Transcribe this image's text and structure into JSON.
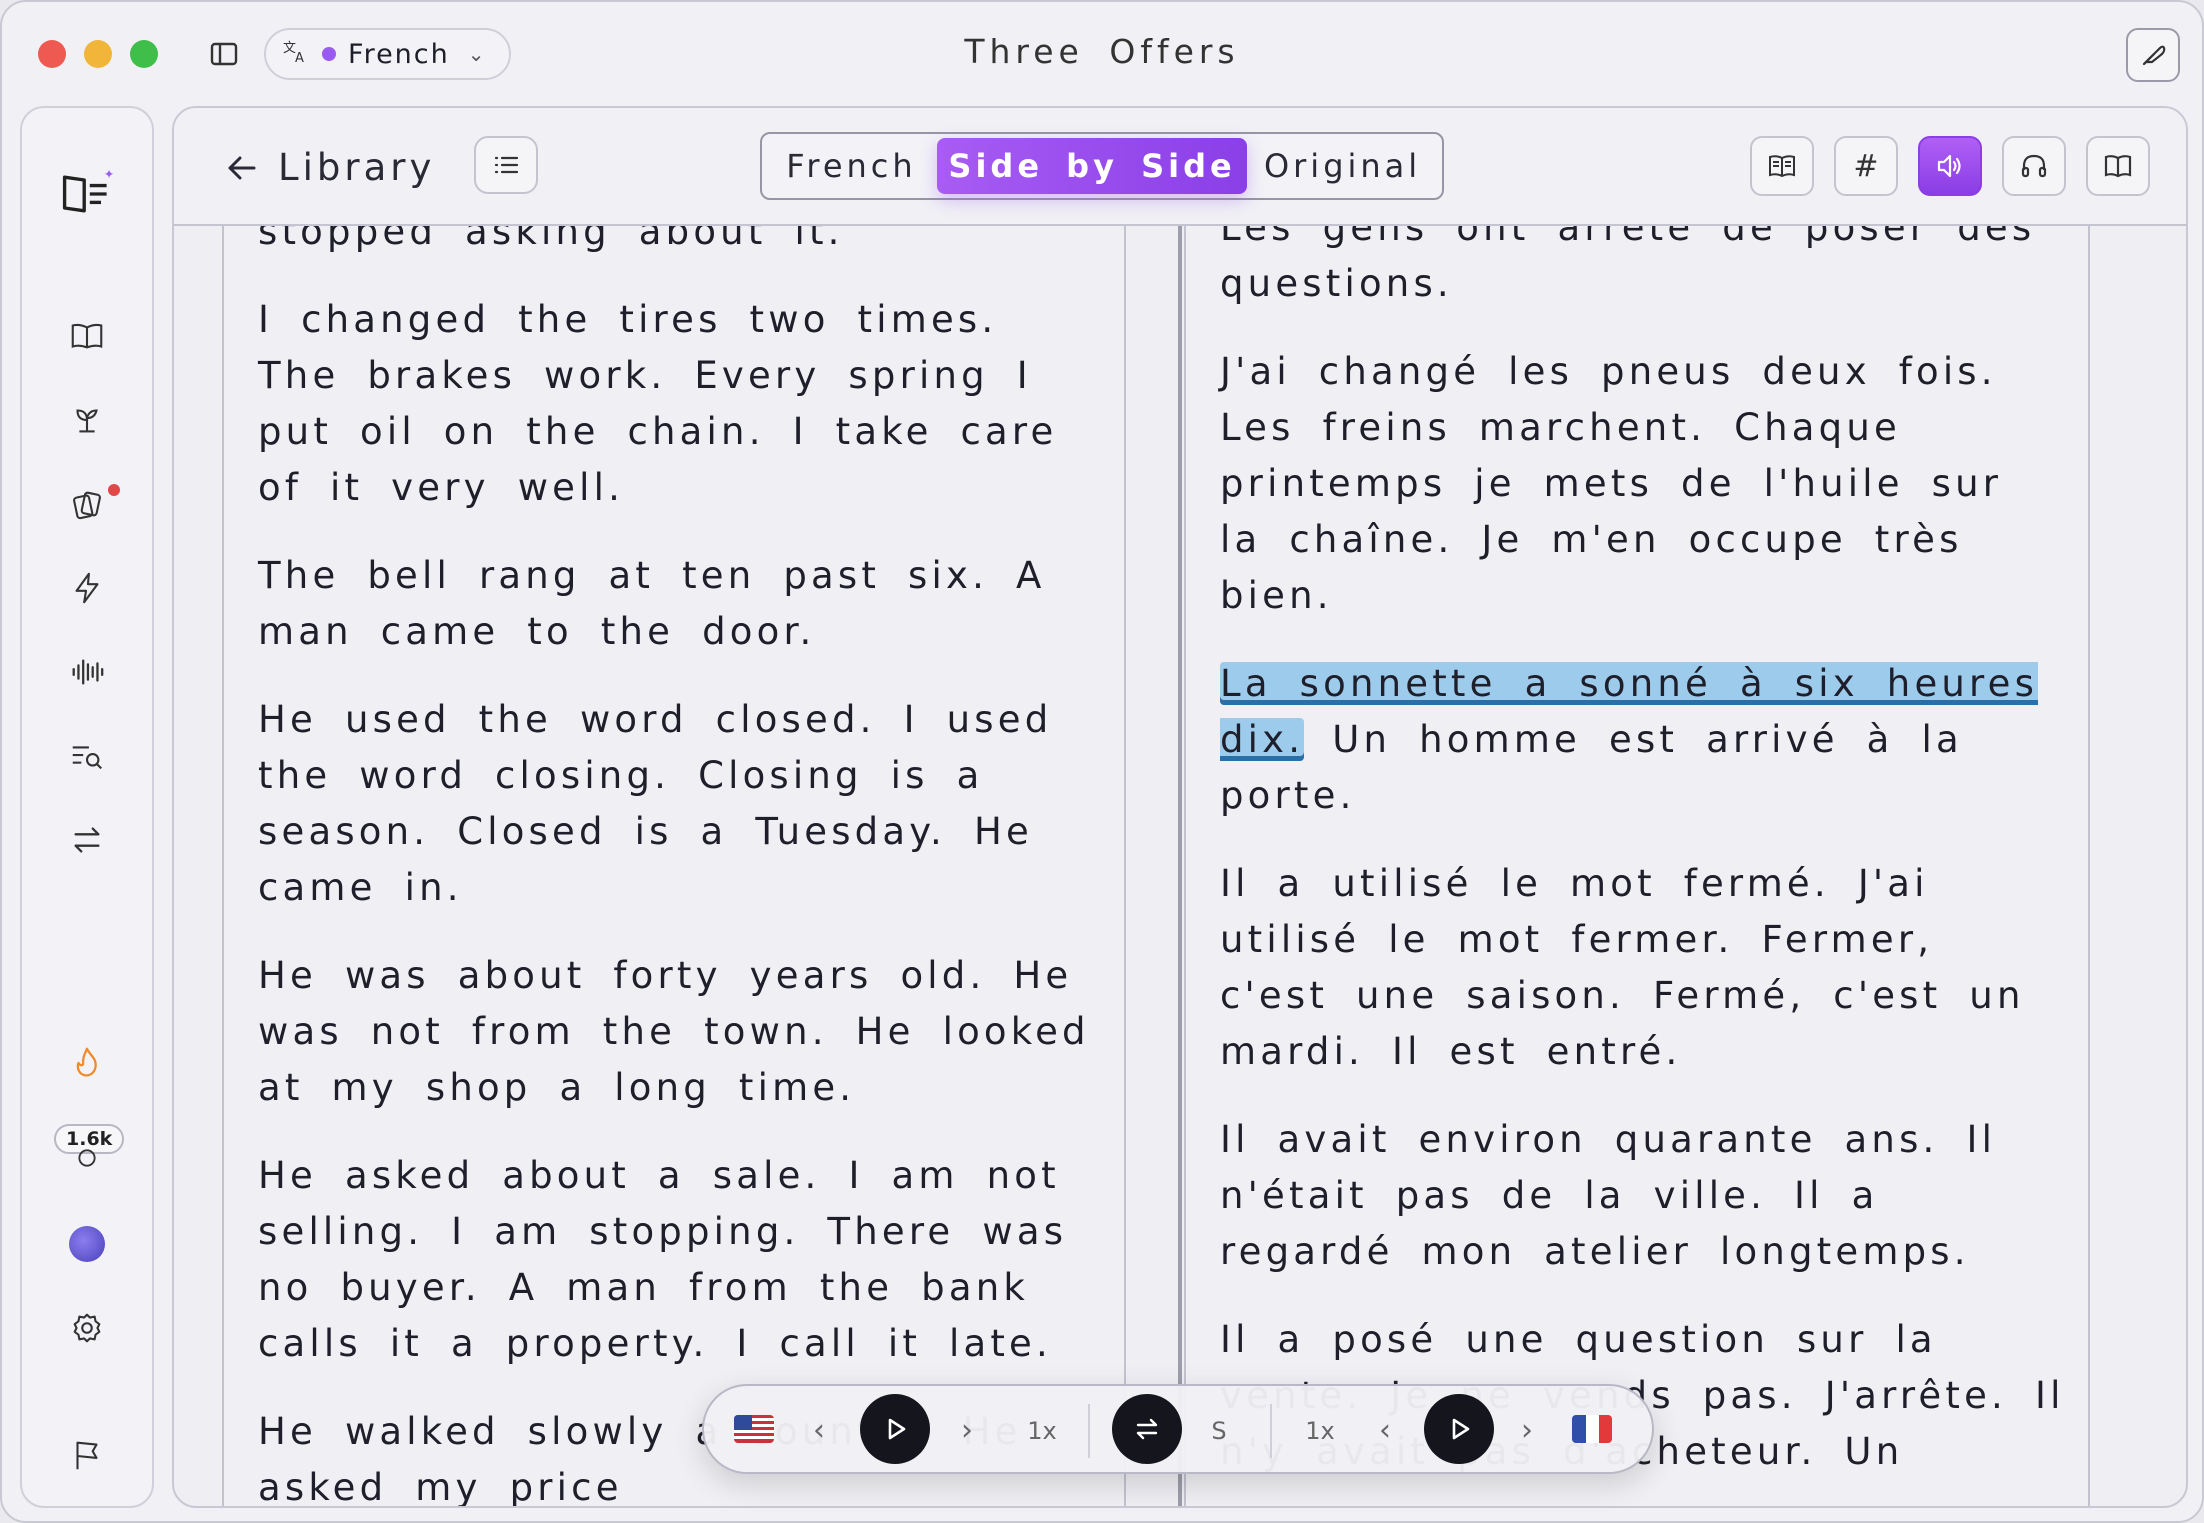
{
  "window": {
    "title": "Three  Offers"
  },
  "language_pill": {
    "label": "French"
  },
  "sidebar": {
    "streak_count": "1.6k"
  },
  "toolbar": {
    "back_label": "Library",
    "view_modes": [
      "French",
      "Side by Side",
      "Original"
    ],
    "active_mode": "Side by Side"
  },
  "left_pane": {
    "paragraphs": [
      "stopped asking about it.",
      "I changed the tires two times. The brakes work. Every spring I put oil on the chain. I take care of it very well.",
      "The bell rang at ten past six. A man came to the door.",
      "He used the word closed. I used the word closing. Closing is a season. Closed is a Tuesday. He came in.",
      "He was about forty years old. He was not from the town. He looked at my shop a long time.",
      "He asked about a sale. I am not selling. I am stopping. There was no buyer. A man from the bank calls it a property. I call it late.",
      "He walked slowly a counter. He asked my price"
    ]
  },
  "right_pane": {
    "paragraphs": [
      "Les gens ont arrêté de poser des questions.",
      "J'ai changé les pneus deux fois. Les freins marchent. Chaque printemps je mets de l'huile sur la chaîne. Je m'en occupe très bien.",
      "",
      "Il a utilisé le mot fermé. J'ai utilisé le mot fermer. Fermer, c'est une saison. Fermé, c'est un mardi. Il est entré.",
      "Il avait environ quarante ans. Il n'était pas de la ville. Il a regardé mon atelier longtemps.",
      "Il a posé une question sur la vente. Je ne vends pas. J'arrête. Il n'y avait pas d'acheteur. Un"
    ],
    "highlighted": "La sonnette a sonné à six heures dix.",
    "after_highlight": " Un homme est arrivé à la porte."
  },
  "player": {
    "left_speed": "1x",
    "swap_label": "S",
    "right_speed": "1x",
    "left_flag": "us-flag",
    "right_flag": "fr-flag"
  },
  "colors": {
    "accent": "#9a4cf0",
    "highlight": "#9ccbeb"
  }
}
